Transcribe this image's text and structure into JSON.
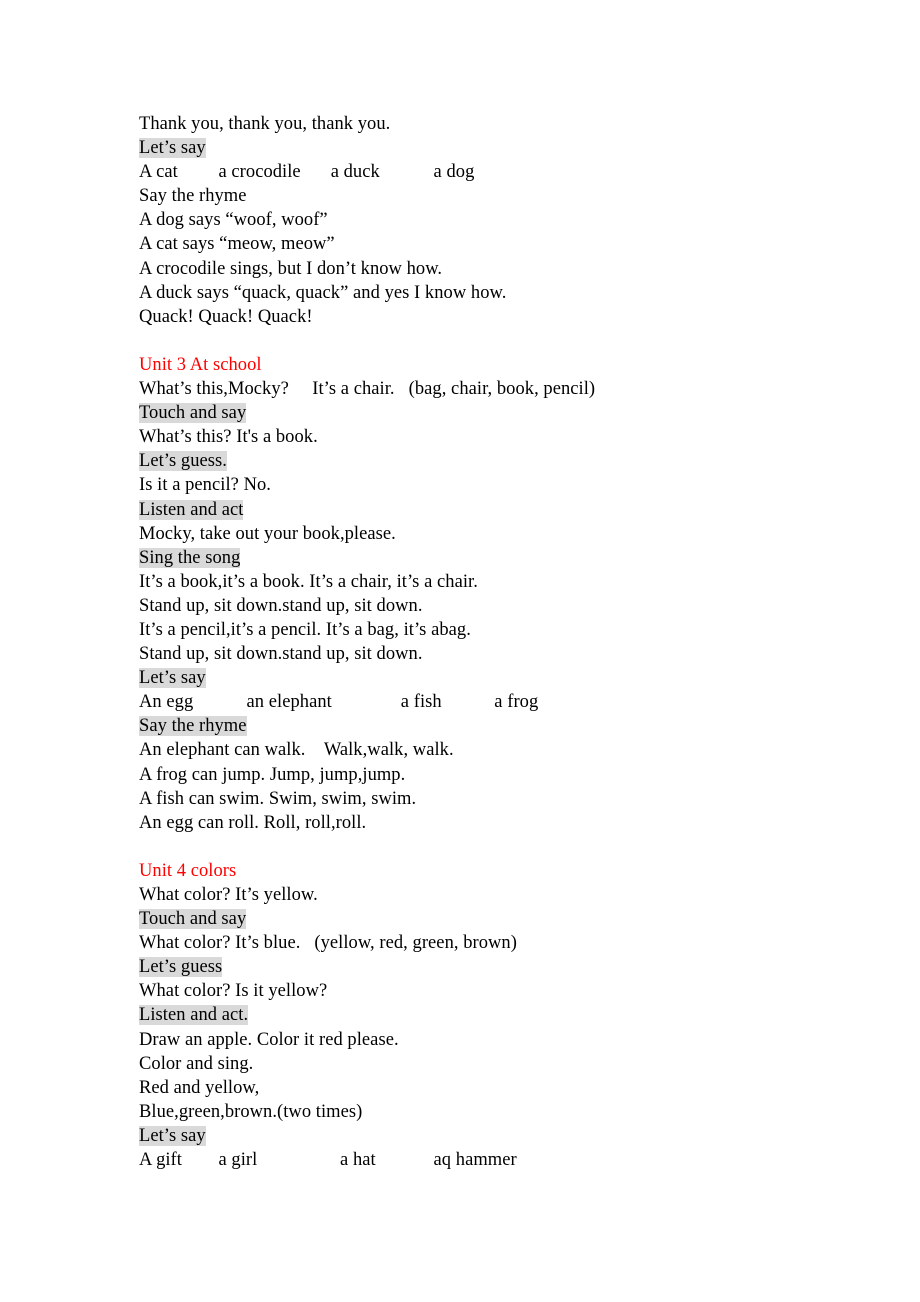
{
  "document": {
    "highlight_color": "#d9d9d9",
    "heading_color": "#ff0000",
    "body_color": "#000000",
    "background_color": "#ffffff"
  },
  "blocks": [
    {
      "id": "unit2-tail",
      "lines": [
        {
          "text": "Thank you, thank you, thank you.",
          "style": "plain"
        },
        {
          "text": "Let’s say",
          "style": "highlight"
        },
        {
          "text": "A cat\t a crocodile\t a duck\t       a dog",
          "style": "plain"
        },
        {
          "text": "Say the rhyme",
          "style": "plain"
        },
        {
          "text": "A dog says “woof, woof”",
          "style": "plain"
        },
        {
          "text": "A cat says “meow, meow”",
          "style": "plain"
        },
        {
          "text": "A crocodile sings, but I don’t know how.",
          "style": "plain"
        },
        {
          "text": "A duck says “quack, quack” and yes I know how.",
          "style": "plain"
        },
        {
          "text": "Quack! Quack! Quack!",
          "style": "plain"
        }
      ]
    },
    {
      "id": "unit3",
      "lines": [
        {
          "text": "Unit 3 At school",
          "style": "heading"
        },
        {
          "text": "What’s this,Mocky?     It’s a chair.   (bag, chair, book, pencil)",
          "style": "plain"
        },
        {
          "text": "Touch and say",
          "style": "highlight"
        },
        {
          "text": "What’s this? It's a book.",
          "style": "plain"
        },
        {
          "text": "Let’s guess.",
          "style": "highlight"
        },
        {
          "text": "Is it a pencil? No.",
          "style": "plain"
        },
        {
          "text": "Listen and act",
          "style": "highlight"
        },
        {
          "text": "Mocky, take out your book,please.",
          "style": "plain"
        },
        {
          "text": "Sing the song",
          "style": "highlight"
        },
        {
          "text": "It’s a book,it’s a book. It’s a chair, it’s a chair.",
          "style": "plain"
        },
        {
          "text": "Stand up, sit down.stand up, sit down.",
          "style": "plain"
        },
        {
          "text": "It’s a pencil,it’s a pencil. It’s a bag, it’s abag.",
          "style": "plain"
        },
        {
          "text": "Stand up, sit down.stand up, sit down.",
          "style": "plain"
        },
        {
          "text": "Let’s say",
          "style": "highlight"
        },
        {
          "text": "An egg\t       an elephant\t        a fish\t    a frog",
          "style": "plain"
        },
        {
          "text": "Say the rhyme",
          "style": "highlight"
        },
        {
          "text": "An elephant can walk.    Walk,walk, walk.",
          "style": "plain"
        },
        {
          "text": "A frog can jump. Jump, jump,jump.",
          "style": "plain"
        },
        {
          "text": "A fish can swim. Swim, swim, swim.",
          "style": "plain"
        },
        {
          "text": "An egg can roll. Roll, roll,roll.",
          "style": "plain"
        }
      ]
    },
    {
      "id": "unit4",
      "lines": [
        {
          "text": "Unit 4 colors",
          "style": "heading"
        },
        {
          "text": "What color? It’s yellow.",
          "style": "plain"
        },
        {
          "text": "Touch and say",
          "style": "highlight"
        },
        {
          "text": "What color? It’s blue.   (yellow, red, green, brown)",
          "style": "plain"
        },
        {
          "text": "Let’s guess",
          "style": "highlight"
        },
        {
          "text": "What color? Is it yellow?",
          "style": "plain"
        },
        {
          "text": "Listen and act.",
          "style": "highlight"
        },
        {
          "text": "Draw an apple. Color it red please.",
          "style": "plain"
        },
        {
          "text": "Color and sing.",
          "style": "plain"
        },
        {
          "text": "Red and yellow,",
          "style": "plain"
        },
        {
          "text": "Blue,green,brown.(two times)",
          "style": "plain"
        },
        {
          "text": "Let’s say",
          "style": "highlight"
        },
        {
          "text": "A gift\t a girl\t           a hat\t       aq hammer",
          "style": "plain"
        }
      ]
    }
  ]
}
